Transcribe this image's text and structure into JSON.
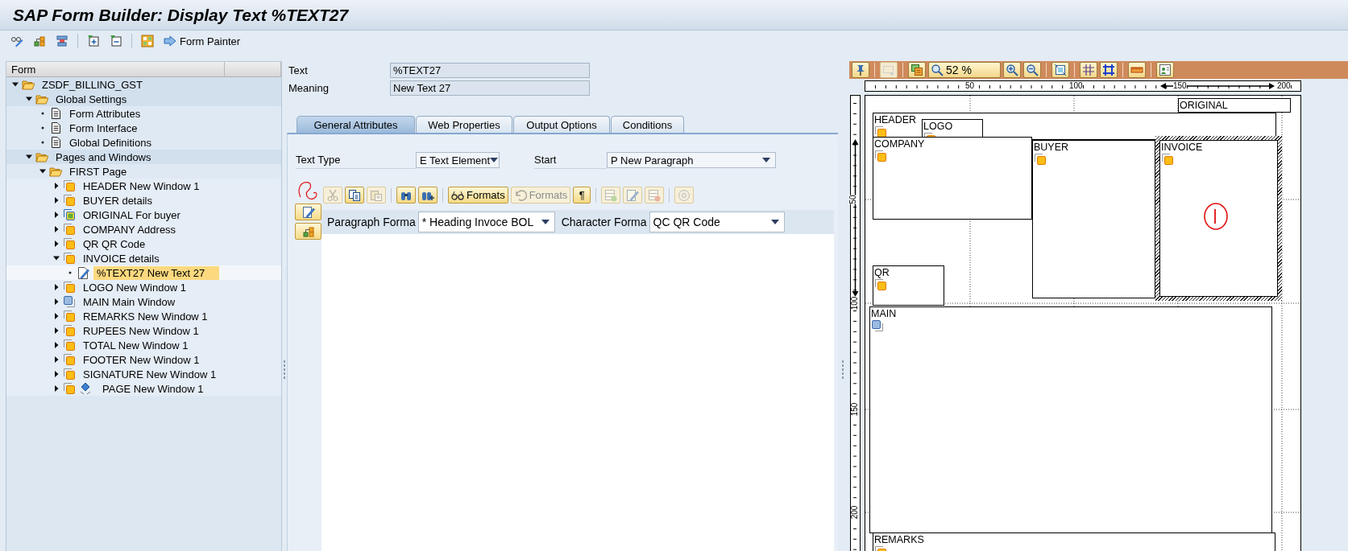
{
  "window": {
    "title": "SAP Form Builder: Display Text %TEXT27"
  },
  "toolbar": [
    [
      {
        "kind": "glasses-pencil"
      },
      {
        "kind": "hierarchy"
      },
      {
        "kind": "stamp"
      }
    ],
    [
      {
        "kind": "expand"
      },
      {
        "kind": "collapse"
      }
    ],
    [
      {
        "kind": "grid-check"
      },
      {
        "kind": "arrow",
        "label": "Form Painter"
      }
    ]
  ],
  "tree": {
    "header": "Form",
    "items": [
      {
        "label": "ZSDF_BILLING_GST",
        "kind": "folder",
        "expanded": true,
        "selected": false,
        "children": [
          {
            "label": "Global Settings",
            "kind": "folder",
            "expanded": true,
            "selected": false,
            "children": [
              {
                "label": "Form Attributes",
                "kind": "doc",
                "selected": false
              },
              {
                "label": "Form Interface",
                "kind": "doc",
                "selected": false
              },
              {
                "label": "Global Definitions",
                "kind": "doc",
                "selected": false
              }
            ]
          },
          {
            "label": "Pages and Windows",
            "kind": "folder",
            "expanded": true,
            "selected": false,
            "children": [
              {
                "label": "FIRST Page",
                "kind": "folder",
                "expanded": true,
                "selected": false,
                "children": [
                  {
                    "label": "HEADER New Window 1",
                    "kind": "window",
                    "expanded": false,
                    "selected": false
                  },
                  {
                    "label": "BUYER details",
                    "kind": "window",
                    "expanded": false,
                    "selected": false
                  },
                  {
                    "label": "ORIGINAL For buyer",
                    "kind": "copies-window",
                    "expanded": false,
                    "selected": false
                  },
                  {
                    "label": "COMPANY Address",
                    "kind": "window",
                    "expanded": false,
                    "selected": false
                  },
                  {
                    "label": "QR QR Code",
                    "kind": "window",
                    "expanded": false,
                    "selected": false
                  },
                  {
                    "label": "INVOICE details",
                    "kind": "window",
                    "expanded": true,
                    "selected": false,
                    "children": [
                      {
                        "label": "%TEXT27 New Text 27",
                        "kind": "text",
                        "selected": true
                      }
                    ]
                  },
                  {
                    "label": "LOGO New Window 1",
                    "kind": "window",
                    "expanded": false,
                    "selected": false
                  },
                  {
                    "label": "MAIN Main Window",
                    "kind": "main-window",
                    "expanded": false,
                    "selected": false
                  },
                  {
                    "label": "REMARKS New Window 1",
                    "kind": "window",
                    "expanded": false,
                    "selected": false
                  },
                  {
                    "label": "RUPEES New Window 1",
                    "kind": "window",
                    "expanded": false,
                    "selected": false
                  },
                  {
                    "label": "TOTAL New Window 1",
                    "kind": "window",
                    "expanded": false,
                    "selected": false
                  },
                  {
                    "label": "FOOTER New Window 1",
                    "kind": "window",
                    "expanded": false,
                    "selected": false
                  },
                  {
                    "label": "SIGNATURE New Window 1",
                    "kind": "window",
                    "expanded": false,
                    "selected": false
                  },
                  {
                    "label": "PAGE New Window 1",
                    "kind": "page-window",
                    "expanded": false,
                    "selected": false
                  }
                ]
              }
            ]
          }
        ]
      }
    ]
  },
  "header_fields": [
    {
      "label": "Text",
      "value": "%TEXT27"
    },
    {
      "label": "Meaning",
      "value": "New Text 27"
    }
  ],
  "tabs": [
    {
      "label": "General Attributes",
      "selected": true
    },
    {
      "label": "Web Properties",
      "selected": false
    },
    {
      "label": "Output Options",
      "selected": false
    },
    {
      "label": "Conditions",
      "selected": false
    }
  ],
  "attributes": [
    {
      "label": "Text Type",
      "value": "E Text Element"
    },
    {
      "label": "Start",
      "value": "P New Paragraph"
    }
  ],
  "editor_toolbar": [
    [
      {
        "kind": "scissors",
        "disabled": true
      },
      {
        "kind": "copy",
        "disabled": false
      },
      {
        "kind": "paste",
        "disabled": true
      }
    ],
    [
      {
        "kind": "binoculars",
        "disabled": false
      },
      {
        "kind": "binoculars-plus",
        "disabled": false
      }
    ],
    [
      {
        "kind": "glasses",
        "label": "Formats",
        "disabled": false
      },
      {
        "kind": "undo",
        "label": "Formats",
        "disabled": true
      },
      {
        "kind": "plain",
        "label": "¶",
        "disabled": false
      }
    ],
    [
      {
        "kind": "row-add",
        "disabled": true
      },
      {
        "kind": "pencil",
        "disabled": true
      },
      {
        "kind": "row-remove",
        "disabled": true
      }
    ],
    [
      {
        "kind": "disk",
        "disabled": true
      }
    ]
  ],
  "side_buttons": [
    {
      "kind": "pencil"
    },
    {
      "kind": "hierarchy"
    }
  ],
  "format_fields": [
    {
      "label": "Paragraph Forma",
      "value": "* Heading Invoce BOL"
    },
    {
      "label": "Character Forma",
      "value": "QC QR Code"
    }
  ],
  "layout_toolbar": [
    [
      {
        "kind": "pin",
        "disabled": false
      }
    ],
    [
      {
        "kind": "select-rect",
        "disabled": true
      }
    ],
    [
      {
        "kind": "layers",
        "disabled": false
      },
      {
        "kind": "zoom",
        "value": "52 %",
        "disabled": false
      },
      {
        "kind": "zoom-in",
        "disabled": false
      },
      {
        "kind": "zoom-out",
        "disabled": false
      }
    ],
    [
      {
        "kind": "fit",
        "disabled": false
      }
    ],
    [
      {
        "kind": "grid",
        "disabled": false
      },
      {
        "kind": "grid-bold",
        "disabled": false
      }
    ],
    [
      {
        "kind": "ruler",
        "disabled": false
      }
    ],
    [
      {
        "kind": "person",
        "disabled": false
      }
    ]
  ],
  "rulers": {
    "horizontal": [
      "50",
      "100",
      "150",
      "200"
    ],
    "vertical": [
      "50",
      "100",
      "150",
      "200"
    ]
  },
  "windows": [
    {
      "name": "ORIGINAL",
      "kind": "copies",
      "selected": false
    },
    {
      "name": "HEADER",
      "kind": "standard",
      "selected": false
    },
    {
      "name": "LOGO",
      "kind": "standard",
      "selected": false
    },
    {
      "name": "COMPANY",
      "kind": "standard",
      "selected": false
    },
    {
      "name": "BUYER",
      "kind": "standard",
      "selected": false
    },
    {
      "name": "INVOICE",
      "kind": "standard",
      "selected": true
    },
    {
      "name": "QR",
      "kind": "standard",
      "selected": false
    },
    {
      "name": "MAIN",
      "kind": "main",
      "selected": false
    },
    {
      "name": "REMARKS",
      "kind": "standard",
      "selected": false
    }
  ]
}
